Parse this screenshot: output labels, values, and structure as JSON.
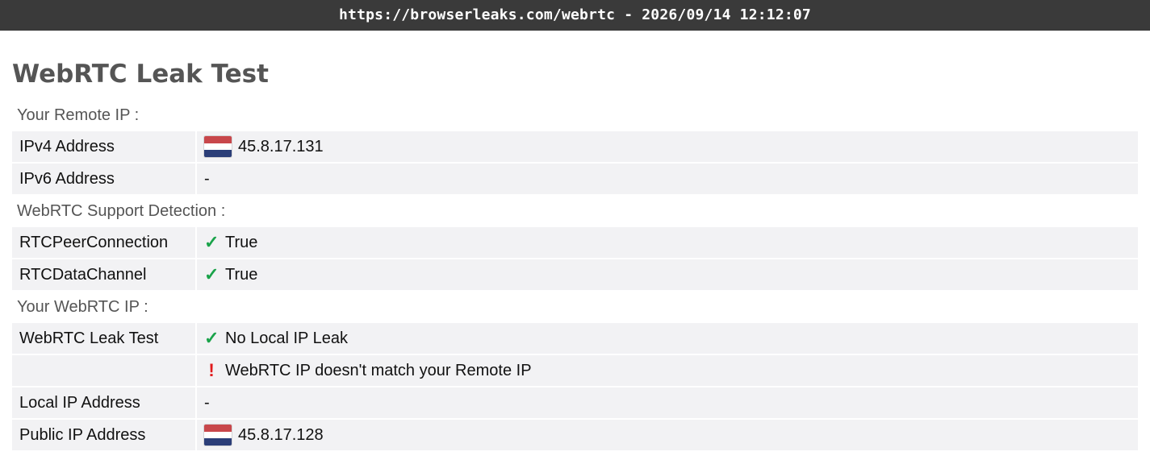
{
  "topbar": {
    "text": "https://browserleaks.com/webrtc - 2026/09/14 12:12:07"
  },
  "page": {
    "title": "WebRTC Leak Test"
  },
  "colors": {
    "flag_top": "#c8474b",
    "flag_mid": "#ffffff",
    "flag_bottom": "#2b3e78",
    "check": "#1aa34a",
    "warn": "#e0191b"
  },
  "icons": {
    "flag": "netherlands-flag-icon",
    "check": "check-icon",
    "warn": "exclamation-icon"
  },
  "sections": {
    "remote_ip": {
      "label": "Your Remote IP :",
      "ipv4": {
        "key": "IPv4 Address",
        "value": "45.8.17.131"
      },
      "ipv6": {
        "key": "IPv6 Address",
        "value": "-"
      }
    },
    "support": {
      "label": "WebRTC Support Detection :",
      "peer": {
        "key": "RTCPeerConnection",
        "value": "True"
      },
      "data": {
        "key": "RTCDataChannel",
        "value": "True"
      }
    },
    "webrtc_ip": {
      "label": "Your WebRTC IP :",
      "leak": {
        "key": "WebRTC Leak Test",
        "value1": "No Local IP Leak",
        "value2": "WebRTC IP doesn't match your Remote IP"
      },
      "local": {
        "key": "Local IP Address",
        "value": "-"
      },
      "public": {
        "key": "Public IP Address",
        "value": "45.8.17.128"
      }
    }
  },
  "glyphs": {
    "check": "✓",
    "warn": "!"
  }
}
